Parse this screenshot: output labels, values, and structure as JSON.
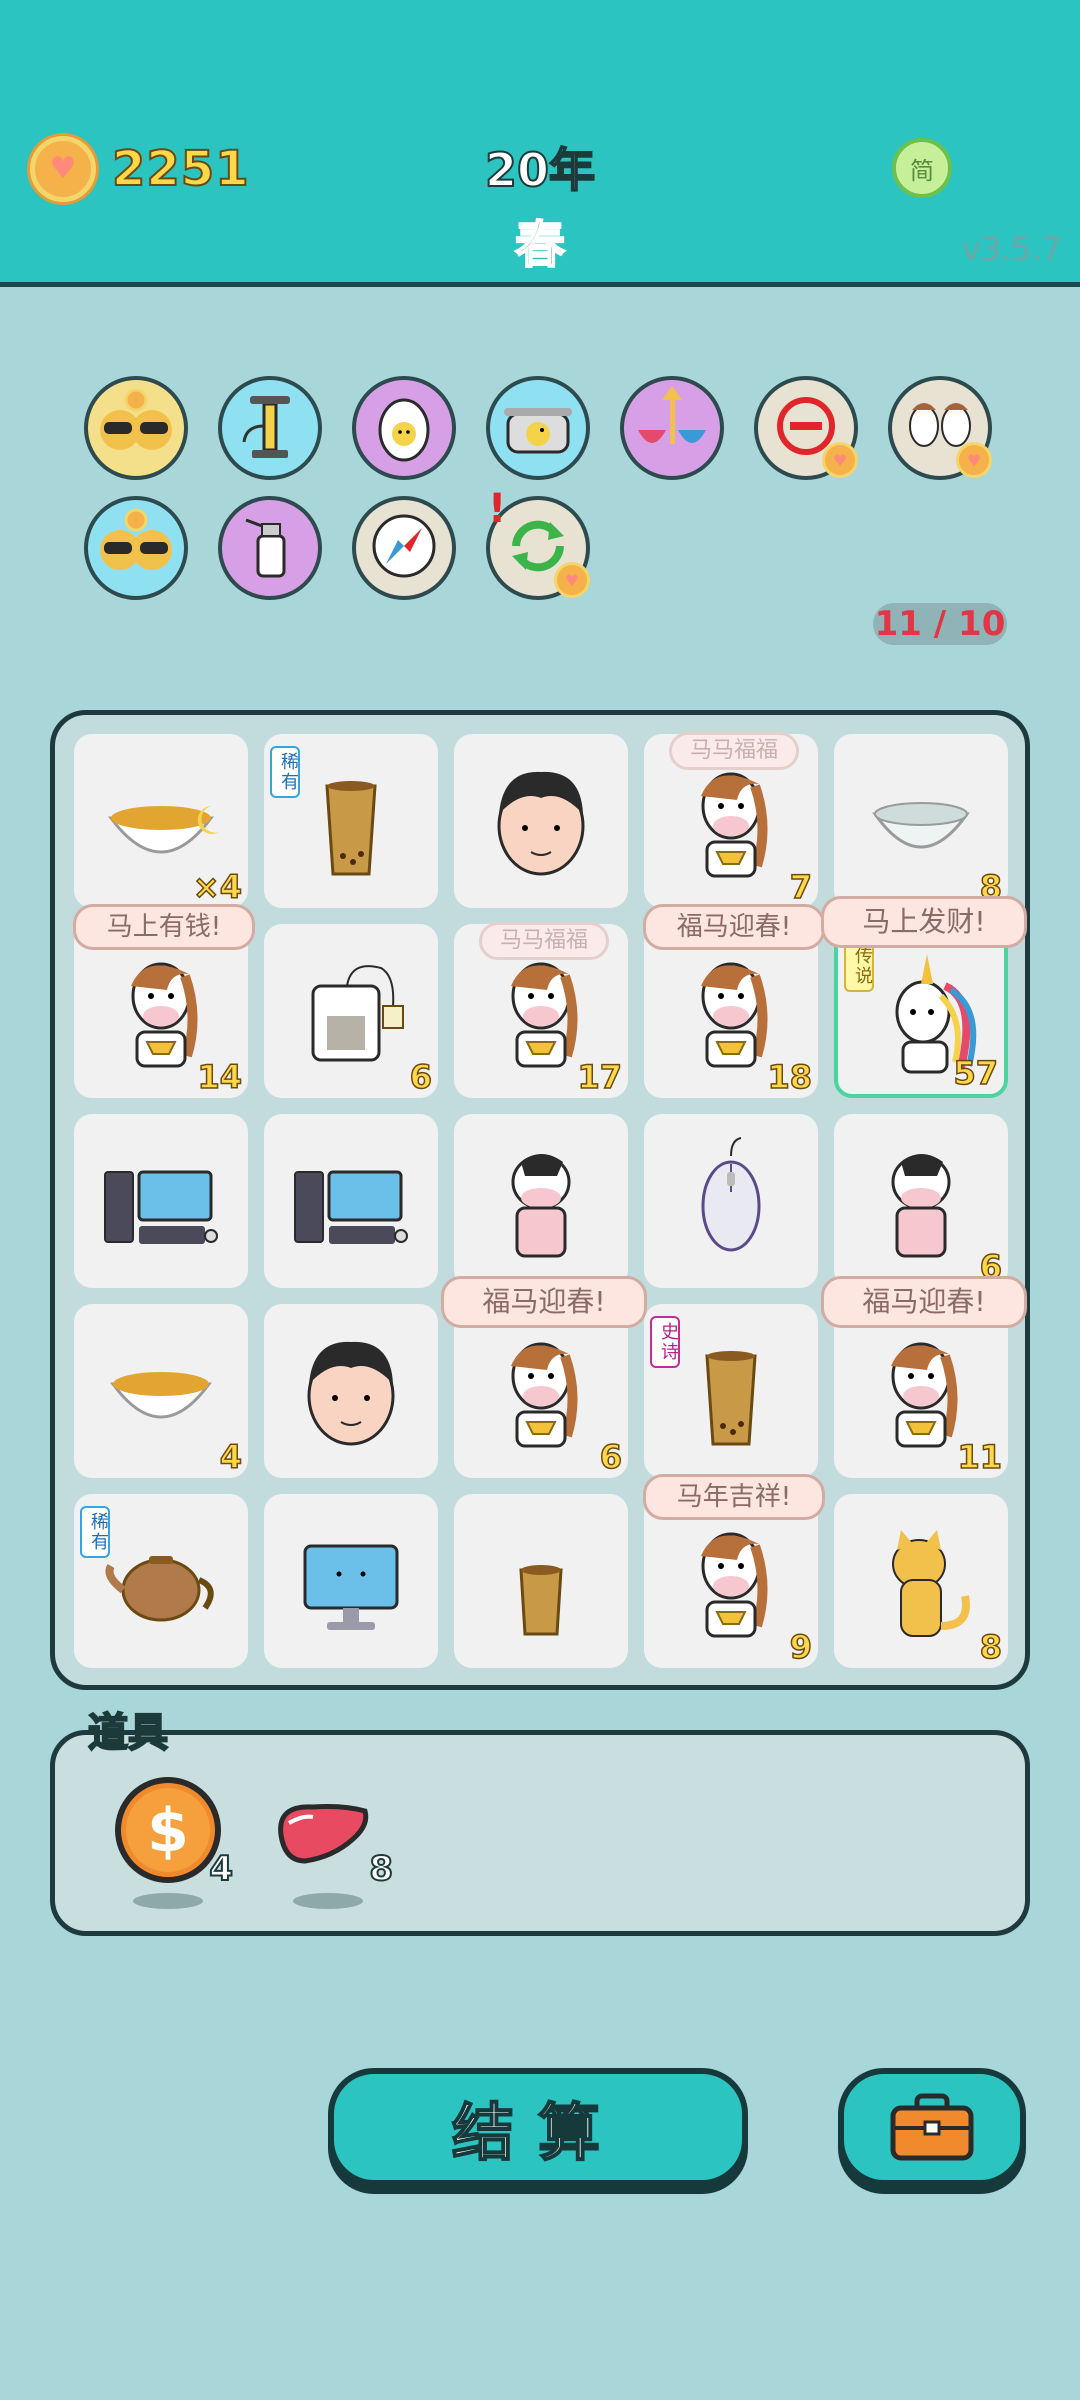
{
  "header": {
    "coins": "2251",
    "year": "20年",
    "season": "春",
    "lang_button": "简",
    "version": "v3.5.7"
  },
  "skills": [
    {
      "icon": "sunglasses-cats-icon"
    },
    {
      "icon": "air-pump-icon"
    },
    {
      "icon": "egg-icon"
    },
    {
      "icon": "duck-pot-icon"
    },
    {
      "icon": "rice-bowls-arrow-icon"
    },
    {
      "icon": "minus-circle-icon"
    },
    {
      "icon": "twin-horses-icon"
    },
    {
      "icon": "sunglasses-cats-icon"
    },
    {
      "icon": "spray-bottle-icon"
    },
    {
      "icon": "compass-icon"
    },
    {
      "icon": "refresh-icon"
    }
  ],
  "counter": "11 / 10",
  "board": {
    "rows": [
      [
        {
          "icon": "tea-bowl-moon-icon",
          "num": "×4",
          "tag": "",
          "bubble": ""
        },
        {
          "icon": "bubble-tea-cup-icon",
          "num": "",
          "tag": "稀有",
          "bubble": ""
        },
        {
          "icon": "man-face-icon",
          "num": "",
          "tag": "",
          "bubble": ""
        },
        {
          "icon": "horse-gold-icon",
          "num": "7",
          "tag": "",
          "bubble": "马马福福"
        },
        {
          "icon": "empty-bowl-icon",
          "num": "8",
          "tag": "",
          "bubble": ""
        }
      ],
      [
        {
          "icon": "horse-gold-icon",
          "num": "14",
          "tag": "",
          "bubble": "马上有钱!"
        },
        {
          "icon": "tea-bag-icon",
          "num": "6",
          "tag": "",
          "bubble": ""
        },
        {
          "icon": "horse-gold-icon",
          "num": "17",
          "tag": "",
          "bubble": "马马福福"
        },
        {
          "icon": "horse-gold-icon",
          "num": "18",
          "tag": "",
          "bubble": "福马迎春!"
        },
        {
          "icon": "unicorn-icon",
          "num": "57",
          "tag": "传说",
          "bubble": "马上发财!"
        }
      ],
      [
        {
          "icon": "desktop-computer-icon",
          "num": "",
          "tag": "",
          "bubble": ""
        },
        {
          "icon": "desktop-computer-icon",
          "num": "",
          "tag": "",
          "bubble": ""
        },
        {
          "icon": "cow-icon",
          "num": "",
          "tag": "",
          "bubble": ""
        },
        {
          "icon": "mouse-icon",
          "num": "",
          "tag": "",
          "bubble": ""
        },
        {
          "icon": "cow-icon",
          "num": "6",
          "tag": "",
          "bubble": ""
        }
      ],
      [
        {
          "icon": "tea-bowl-icon",
          "num": "4",
          "tag": "",
          "bubble": ""
        },
        {
          "icon": "man-face-icon",
          "num": "",
          "tag": "",
          "bubble": ""
        },
        {
          "icon": "horse-gold-icon",
          "num": "6",
          "tag": "",
          "bubble": "福马迎春!"
        },
        {
          "icon": "bubble-tea-cup-icon",
          "num": "",
          "tag": "史诗",
          "bubble": ""
        },
        {
          "icon": "horse-gold-icon",
          "num": "11",
          "tag": "",
          "bubble": "福马迎春!"
        }
      ],
      [
        {
          "icon": "teapot-icon",
          "num": "",
          "tag": "稀有",
          "bubble": ""
        },
        {
          "icon": "monitor-icon",
          "num": "",
          "tag": "",
          "bubble": ""
        },
        {
          "icon": "small-bubble-tea-icon",
          "num": "",
          "tag": "",
          "bubble": ""
        },
        {
          "icon": "horse-gold-icon",
          "num": "9",
          "tag": "",
          "bubble": "马年吉祥!"
        },
        {
          "icon": "cat-icon",
          "num": "8",
          "tag": "",
          "bubble": ""
        }
      ]
    ]
  },
  "items": {
    "title": "道具",
    "list": [
      {
        "icon": "dollar-coin-icon",
        "count": "4"
      },
      {
        "icon": "liver-icon",
        "count": "8"
      }
    ]
  },
  "buttons": {
    "settle": "结算",
    "bag": "briefcase-icon"
  },
  "colors": {
    "header_bg": "#2cc4c0",
    "page_bg": "#a9d6d9",
    "coin_text": "#ffd84a",
    "counter_text": "#e03645"
  }
}
